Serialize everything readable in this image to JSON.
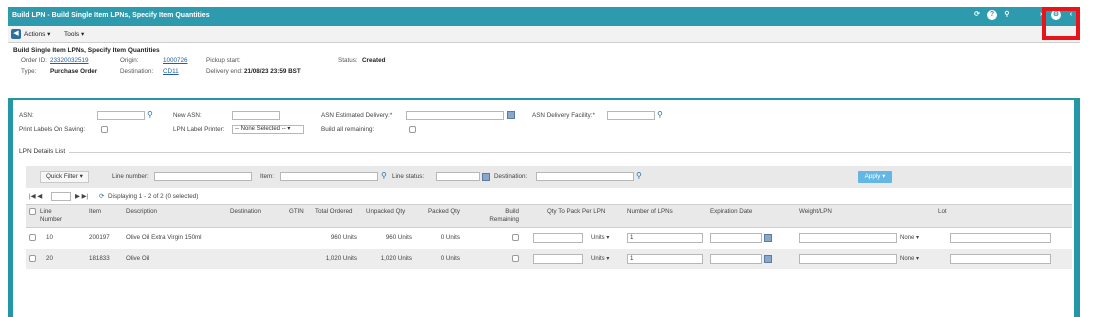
{
  "window": {
    "title": "Build LPN - Build Single Item LPNs, Specify Item Quantities"
  },
  "toolbar": {
    "actions_label": "Actions",
    "tools_label": "Tools"
  },
  "header": {
    "title": "Build Single Item LPNs, Specify Item Quantities",
    "order_id_label": "Order ID:",
    "order_id_value": "23320032519",
    "origin_label": "Origin:",
    "origin_value": "1000726",
    "pickup_start_label": "Pickup start:",
    "status_label": "Status:",
    "status_value": "Created",
    "type_label": "Type:",
    "type_value": "Purchase Order",
    "destination_label": "Destination:",
    "destination_value": "CD11",
    "delivery_end_label": "Delivery end:",
    "delivery_end_value": "21/08/23 23:59 BST"
  },
  "form": {
    "asn_label": "ASN:",
    "new_asn_label": "New ASN:",
    "asn_estimated_delivery_label": "ASN Estimated Delivery:*",
    "asn_delivery_facility_label": "ASN Delivery Facility:*",
    "print_labels_label": "Print Labels On Saving:",
    "lpn_label_printer_label": "LPN Label Printer:",
    "lpn_label_printer_value": "-- None Selected --",
    "build_all_remaining_label": "Build all remaining:"
  },
  "lpn_details": {
    "section_title": "LPN Details List",
    "quick_filter_label": "Quick Filter",
    "line_number_label": "Line number:",
    "item_label": "Item:",
    "line_status_label": "Line status:",
    "destination_label": "Destination:",
    "apply_label": "Apply",
    "pager_text": "Displaying 1 - 2 of 2 (0 selected)",
    "columns": [
      "Line Number",
      "Item",
      "Description",
      "Destination",
      "GTIN",
      "Total Ordered",
      "Unpacked Qty",
      "Packed Qty",
      "Build Remaining",
      "Qty To Pack Per LPN",
      "Number of LPNs",
      "Expiration Date",
      "Weight/LPN",
      "Lot"
    ],
    "rows": [
      {
        "line": "10",
        "item": "200197",
        "description": "Olive Oil Extra Virgin 150ml",
        "total_ordered": "960 Units",
        "unpacked_qty": "960 Units",
        "packed_qty": "0 Units",
        "uom": "Units",
        "num_lpns": "1",
        "weight_unit": "None"
      },
      {
        "line": "20",
        "item": "181833",
        "description": "Olive Oil",
        "total_ordered": "1,020 Units",
        "unpacked_qty": "1,020 Units",
        "packed_qty": "0 Units",
        "uom": "Units",
        "num_lpns": "1",
        "weight_unit": "None"
      }
    ]
  },
  "icons": {
    "title_icons": [
      "refresh-icon",
      "help-icon",
      "location-icon"
    ],
    "corner_icons": [
      "user-icon",
      "settings-icon"
    ]
  },
  "colors": {
    "frame": "#2596a8",
    "highlight": "#e8141c",
    "apply": "#62b7e3"
  }
}
